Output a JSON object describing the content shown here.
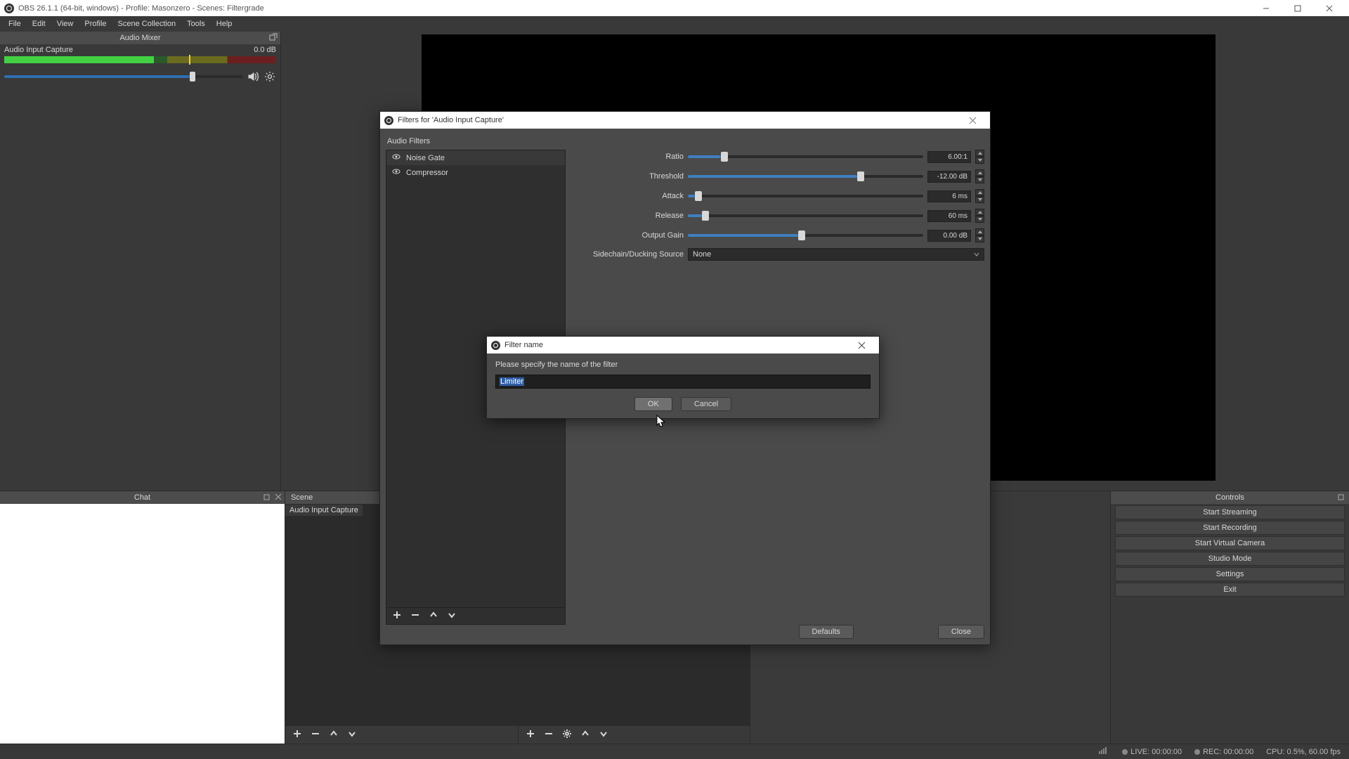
{
  "title": "OBS 26.1.1 (64-bit, windows) - Profile: Masonzero - Scenes: Filtergrade",
  "menu": [
    "File",
    "Edit",
    "View",
    "Profile",
    "Scene Collection",
    "Tools",
    "Help"
  ],
  "mixer": {
    "title": "Audio Mixer",
    "source": "Audio Input Capture",
    "level": "0.0 dB"
  },
  "chat": {
    "title": "Chat"
  },
  "scene": {
    "title": "Scene"
  },
  "source_label": "Audio Input Capture",
  "controls": {
    "title": "Controls",
    "buttons": [
      "Start Streaming",
      "Start Recording",
      "Start Virtual Camera",
      "Studio Mode",
      "Settings",
      "Exit"
    ]
  },
  "status": {
    "live": "LIVE: 00:00:00",
    "rec": "REC: 00:00:00",
    "cpu": "CPU: 0.5%, 60.00 fps"
  },
  "filters_dialog": {
    "title": "Filters for 'Audio Input Capture'",
    "section": "Audio Filters",
    "items": [
      "Noise Gate",
      "Compressor"
    ],
    "props": {
      "ratio": {
        "label": "Ratio",
        "value": "6.00:1",
        "fill": 14
      },
      "threshold": {
        "label": "Threshold",
        "value": "-12.00 dB",
        "fill": 72
      },
      "attack": {
        "label": "Attack",
        "value": "6 ms",
        "fill": 3
      },
      "release": {
        "label": "Release",
        "value": "60 ms",
        "fill": 6
      },
      "gain": {
        "label": "Output Gain",
        "value": "0.00 dB",
        "fill": 47
      },
      "sidechain": {
        "label": "Sidechain/Ducking Source",
        "value": "None"
      }
    },
    "defaults": "Defaults",
    "close": "Close"
  },
  "name_dialog": {
    "title": "Filter name",
    "prompt": "Please specify the name of the filter",
    "value": "Limiter",
    "ok": "OK",
    "cancel": "Cancel"
  }
}
